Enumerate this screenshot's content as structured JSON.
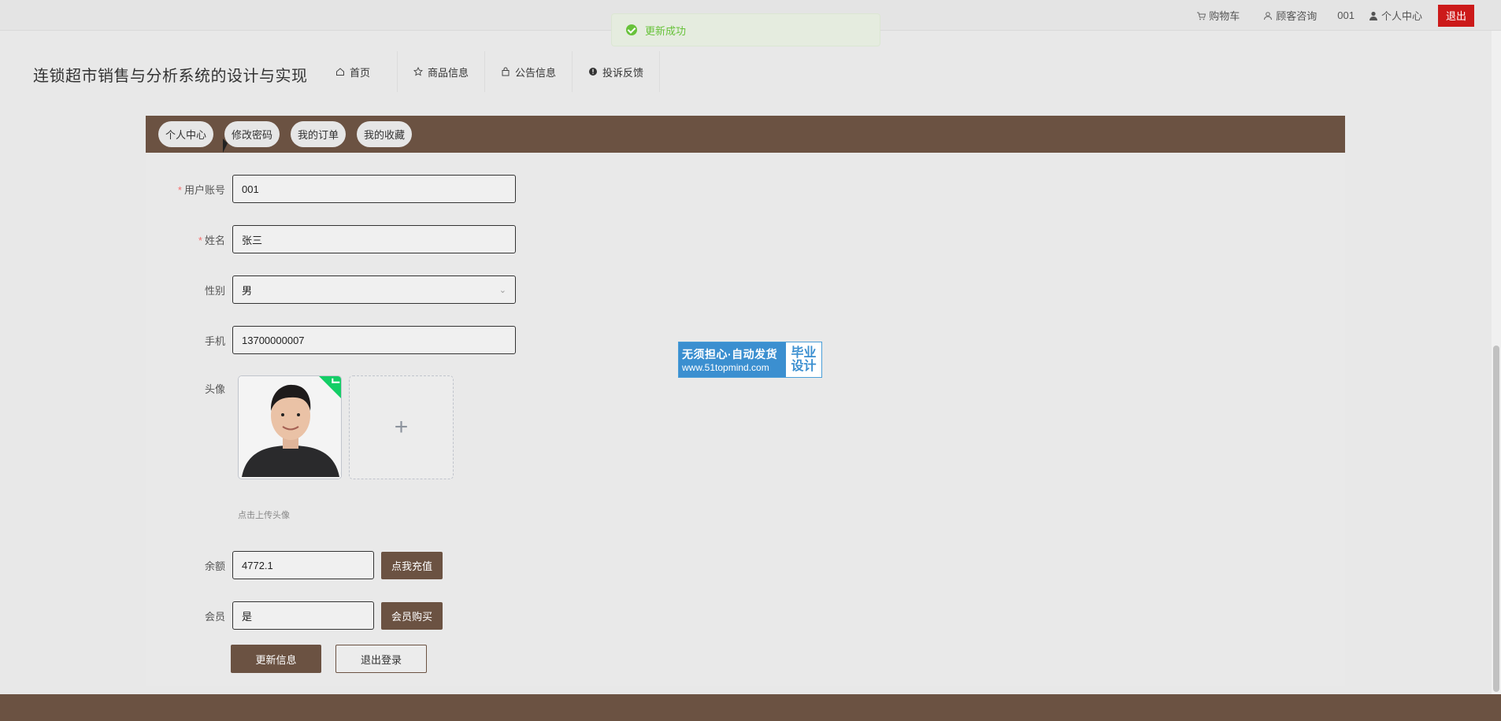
{
  "topbar": {
    "cart_label": "购物车",
    "service_label": "顾客咨询",
    "username": "001",
    "profile_label": "个人中心",
    "logout_label": "退出"
  },
  "toast": {
    "message": "更新成功"
  },
  "site": {
    "title": "连锁超市销售与分析系统的设计与实现"
  },
  "nav": {
    "items": [
      {
        "label": "首页",
        "icon": "home-icon"
      },
      {
        "label": "商品信息",
        "icon": "star-icon"
      },
      {
        "label": "公告信息",
        "icon": "bag-icon"
      },
      {
        "label": "投诉反馈",
        "icon": "alert-icon"
      }
    ]
  },
  "tabs": [
    "个人中心",
    "修改密码",
    "我的订单",
    "我的收藏"
  ],
  "form": {
    "account_label": "用户账号",
    "account_value": "001",
    "name_label": "姓名",
    "name_value": "张三",
    "gender_label": "性别",
    "gender_value": "男",
    "phone_label": "手机",
    "phone_value": "13700000007",
    "avatar_label": "头像",
    "upload_hint": "点击上传头像",
    "balance_label": "余额",
    "balance_value": "4772.1",
    "recharge_label": "点我充值",
    "member_label": "会员",
    "member_value": "是",
    "buy_member_label": "会员购买",
    "update_label": "更新信息",
    "logout_label": "退出登录"
  },
  "watermark": {
    "line1": "无须担心·自动发货",
    "line2": "www.51topmind.com",
    "side": "毕业设计"
  },
  "colors": {
    "brand": "#6b5242",
    "danger": "#cc1a1a",
    "success": "#67c23a"
  }
}
